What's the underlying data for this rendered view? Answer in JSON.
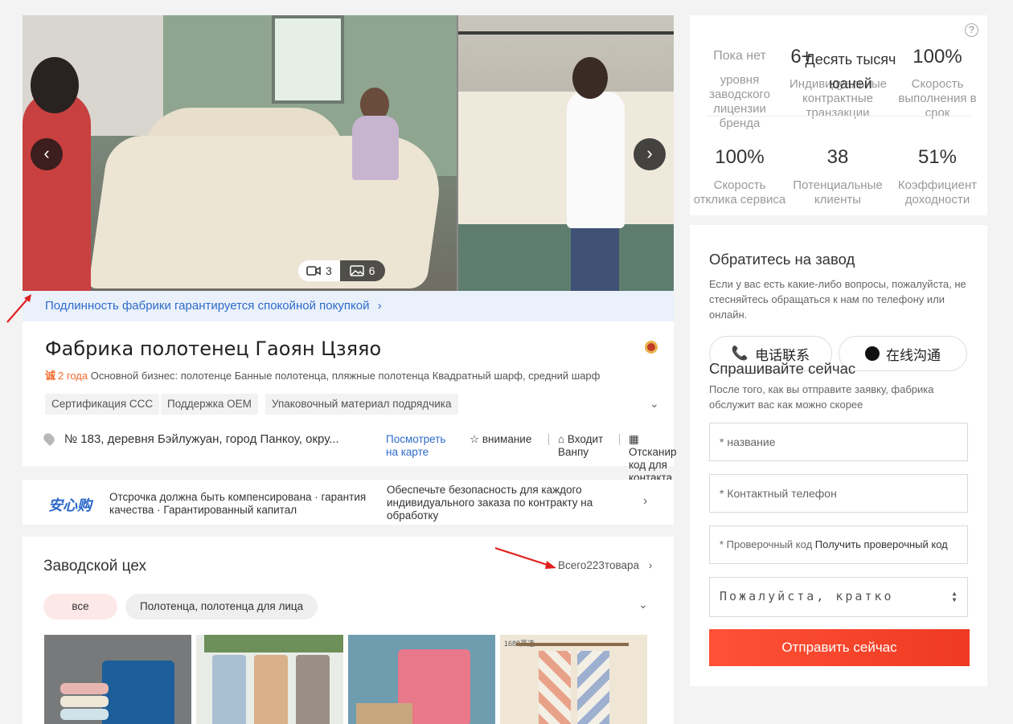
{
  "gallery": {
    "video_count": "3",
    "photo_count": "6",
    "prev_label": "‹",
    "next_label": "›"
  },
  "auth_bar": {
    "text": "Подлинность фабрики гарантируется спокойной покупкой",
    "chevron": "›"
  },
  "company": {
    "name": "Фабрика полотенец Гаоян Цзяяо",
    "cheng_icon": "诚",
    "years": "2 года",
    "business": "Основной бизнес: полотенце Банные полотенца, пляжные полотенца Квадратный шарф, средний шарф",
    "tags": [
      "Сертификация CCC",
      "Поддержка OEM",
      "Упаковочный материал подрядчика"
    ],
    "address": "№ 183, деревня Бэйлужуан, город Панкоу, окру...",
    "map_link": "Посмотреть на карте",
    "actions": {
      "follow": "внимание",
      "enter_shop": "Входит Ванпу",
      "scan_code": "Отсканир код для контакта"
    }
  },
  "assurance": {
    "logo": "安心购",
    "left_text": "Отсрочка должна быть компенсирована · гарантия качества · Гарантированный капитал",
    "right_text": "Обеспечьте безопасность для каждого индивидуального заказа по контракту на обработку",
    "chevron": "›"
  },
  "workshop": {
    "title": "Заводской цех",
    "total": "Всего223товара",
    "total_chevron": "›",
    "categories": [
      "все",
      "Полотенца, полотенца для лица"
    ],
    "product_badge": "1688严选"
  },
  "stats": {
    "help": "?",
    "items": [
      {
        "value": "Пока нет",
        "label": "уровня заводского лицензии бренда"
      },
      {
        "value": "6+",
        "label": "Индивидуальные контрактные транзакции"
      },
      {
        "value": "Десять тысяч юаней",
        "label": ""
      },
      {
        "value": "100%",
        "label": "Скорость выполнения в срок"
      },
      {
        "value": "100%",
        "label": "Скорость отклика сервиса"
      },
      {
        "value": "38",
        "label": "Потенциальные клиенты"
      },
      {
        "value": "51%",
        "label": "Коэффициент доходности"
      }
    ]
  },
  "contact": {
    "title": "Обратитесь на завод",
    "desc": "Если у вас есть какие-либо вопросы, пожалуйста, не стесняйтесь обращаться к нам по телефону или онлайн.",
    "phone_btn": "电话联系",
    "chat_btn": "在线沟通",
    "ask_title": "Спрашивайте сейчас",
    "ask_desc": "После того, как вы отправите заявку, фабрика обслужит вас как можно скорее",
    "name_placeholder": "* название",
    "phone_placeholder": "* Контактный телефон",
    "code_placeholder": "* Проверочный код",
    "code_link": "Получить проверочный код",
    "message_placeholder": "Пожалуйста, кратко",
    "submit": "Отправить сейчас"
  },
  "colors": {
    "accent_blue": "#2e6bc9",
    "submit_red": "#f0442b",
    "annotation_red": "#e0201e"
  }
}
